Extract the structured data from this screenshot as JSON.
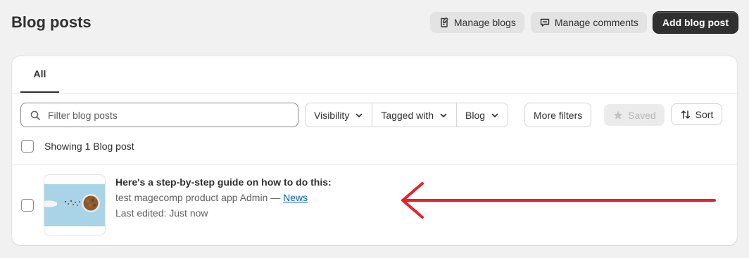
{
  "header": {
    "title": "Blog posts",
    "manage_blogs_label": "Manage blogs",
    "manage_comments_label": "Manage comments",
    "add_post_label": "Add blog post"
  },
  "tabs": [
    {
      "label": "All",
      "selected": true
    }
  ],
  "search": {
    "placeholder": "Filter blog posts",
    "value": ""
  },
  "filters": {
    "visibility_label": "Visibility",
    "tagged_with_label": "Tagged with",
    "blog_label": "Blog",
    "more_filters_label": "More filters",
    "saved_label": "Saved",
    "sort_label": "Sort"
  },
  "summary": {
    "showing_label": "Showing 1 Blog post"
  },
  "posts": [
    {
      "title": "Here's a step-by-step guide on how to do this:",
      "meta_prefix": "test magecomp product app Admin — ",
      "blog_link": "News",
      "edited": "Last edited: Just now",
      "thumbnail_icon": "food-bowl-thumbnail"
    }
  ],
  "colors": {
    "background": "#f1f1f1",
    "primary_button": "#303030",
    "link": "#005bd3",
    "annotation_arrow": "#e8202a"
  },
  "icons": {
    "manage_blogs": "edit-document-icon",
    "manage_comments": "chat-bubble-icon",
    "search": "search-icon",
    "chevron": "chevron-down-icon",
    "saved": "star-icon",
    "sort": "sort-arrows-icon"
  }
}
